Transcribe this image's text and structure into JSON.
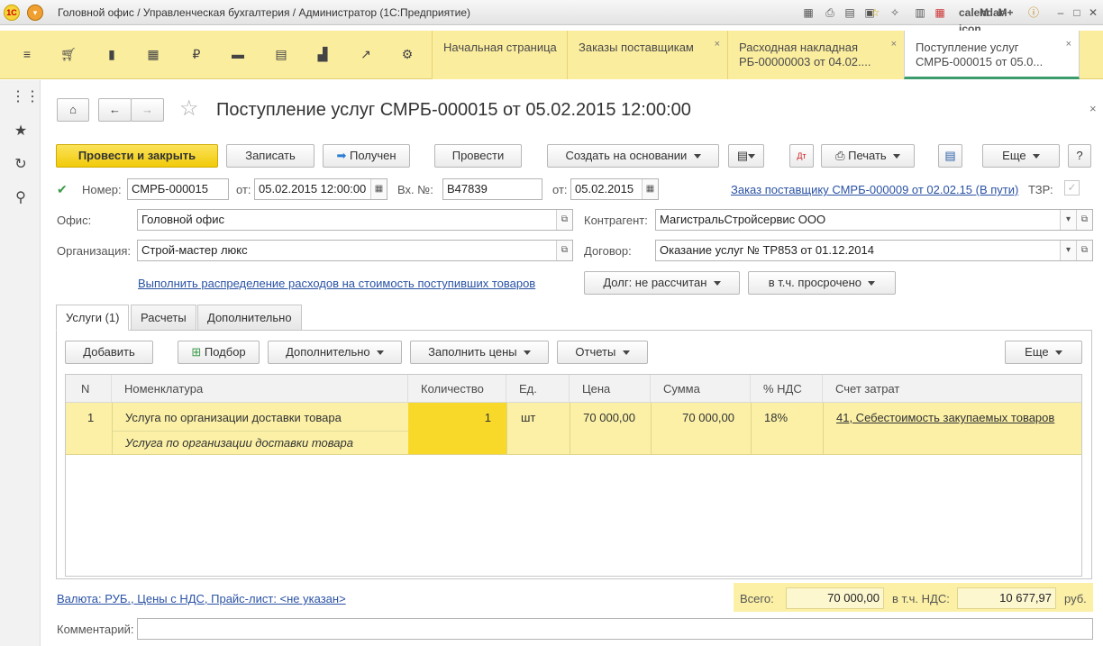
{
  "window": {
    "title": "Головной офис / Управленческая бухгалтерия / Администратор  (1С:Предприятие)",
    "logo": "1С",
    "titlebar_icons": [
      "history-icon",
      "print-icon",
      "preview-icon",
      "save-icon",
      "favorite-add-icon",
      "favorites-icon",
      "calc-icon",
      "calendar-icon",
      "M",
      "M+",
      "M-",
      "info-icon",
      "minimize-icon",
      "maximize-icon",
      "close-icon"
    ]
  },
  "sections": {
    "icons": [
      "menu-icon",
      "cart-icon",
      "bag-icon",
      "warehouse-icon",
      "money-icon",
      "truck-icon",
      "docs-icon",
      "chart-icon",
      "trend-icon",
      "gear-icon"
    ]
  },
  "open_tabs": [
    {
      "label": "Начальная страница",
      "close": ""
    },
    {
      "label": "Заказы поставщикам",
      "close": "×"
    },
    {
      "label": "Расходная накладная РБ-00000003 от 04.02....",
      "close": "×"
    },
    {
      "label": "Поступление услуг СМРБ-000015 от 05.0...",
      "close": "×"
    }
  ],
  "left_panel": {
    "icons": [
      "apps-grid-icon",
      "star-icon",
      "history-icon",
      "search-icon"
    ]
  },
  "doc": {
    "title": "Поступление услуг СМРБ-000015 от 05.02.2015 12:00:00"
  },
  "toolbar": {
    "post_close": "Провести и закрыть",
    "save": "Записать",
    "received": "Получен",
    "post": "Провести",
    "create_based": "Создать на основании",
    "print": "Печать",
    "more": "Еще",
    "help": "?"
  },
  "header": {
    "number_label": "Номер:",
    "number": "СМРБ-000015",
    "from_label": "от:",
    "date": "05.02.2015 12:00:00",
    "in_number_label": "Вх. №:",
    "in_number": "В47839",
    "in_from_label": "от:",
    "in_date": "05.02.2015",
    "order_link": "Заказ поставщику СМРБ-000009 от 02.02.15 (В пути)",
    "tzr_label": "ТЗР:",
    "office_label": "Офис:",
    "office": "Головной офис",
    "org_label": "Организация:",
    "org": "Строй-мастер люкс",
    "contractor_label": "Контрагент:",
    "contractor": "МагистральСтройсервис ООО",
    "contract_label": "Договор:",
    "contract": "Оказание услуг № ТР853 от 01.12.2014",
    "distribute_link": "Выполнить распределение расходов на стоимость поступивших товаров",
    "debt": "Долг: не рассчитан",
    "overdue": "в т.ч. просрочено"
  },
  "form_tabs": [
    "Услуги (1)",
    "Расчеты",
    "Дополнительно"
  ],
  "table_toolbar": {
    "add": "Добавить",
    "select": "Подбор",
    "extra": "Дополнительно",
    "fill_prices": "Заполнить цены",
    "reports": "Отчеты",
    "more": "Еще"
  },
  "table": {
    "columns": [
      "N",
      "Номенклатура",
      "Количество",
      "Ед.",
      "Цена",
      "Сумма",
      "% НДС",
      "Счет затрат"
    ],
    "rows": [
      {
        "n": "1",
        "item": "Услуга по организации доставки товара",
        "item_desc": "Услуга по организации доставки товара",
        "qty": "1",
        "unit": "шт",
        "price": "70 000,00",
        "sum": "70 000,00",
        "vat": "18%",
        "account": "41, Себестоимость закупаемых товаров"
      }
    ]
  },
  "footer": {
    "currency_link": "Валюта: РУБ., Цены с НДС, Прайс-лист: <не указан>",
    "total_label": "Всего:",
    "total": "70 000,00",
    "vat_label": "в т.ч. НДС:",
    "vat": "10 677,97",
    "currency": "руб.",
    "comment_label": "Комментарий:",
    "comment": ""
  }
}
